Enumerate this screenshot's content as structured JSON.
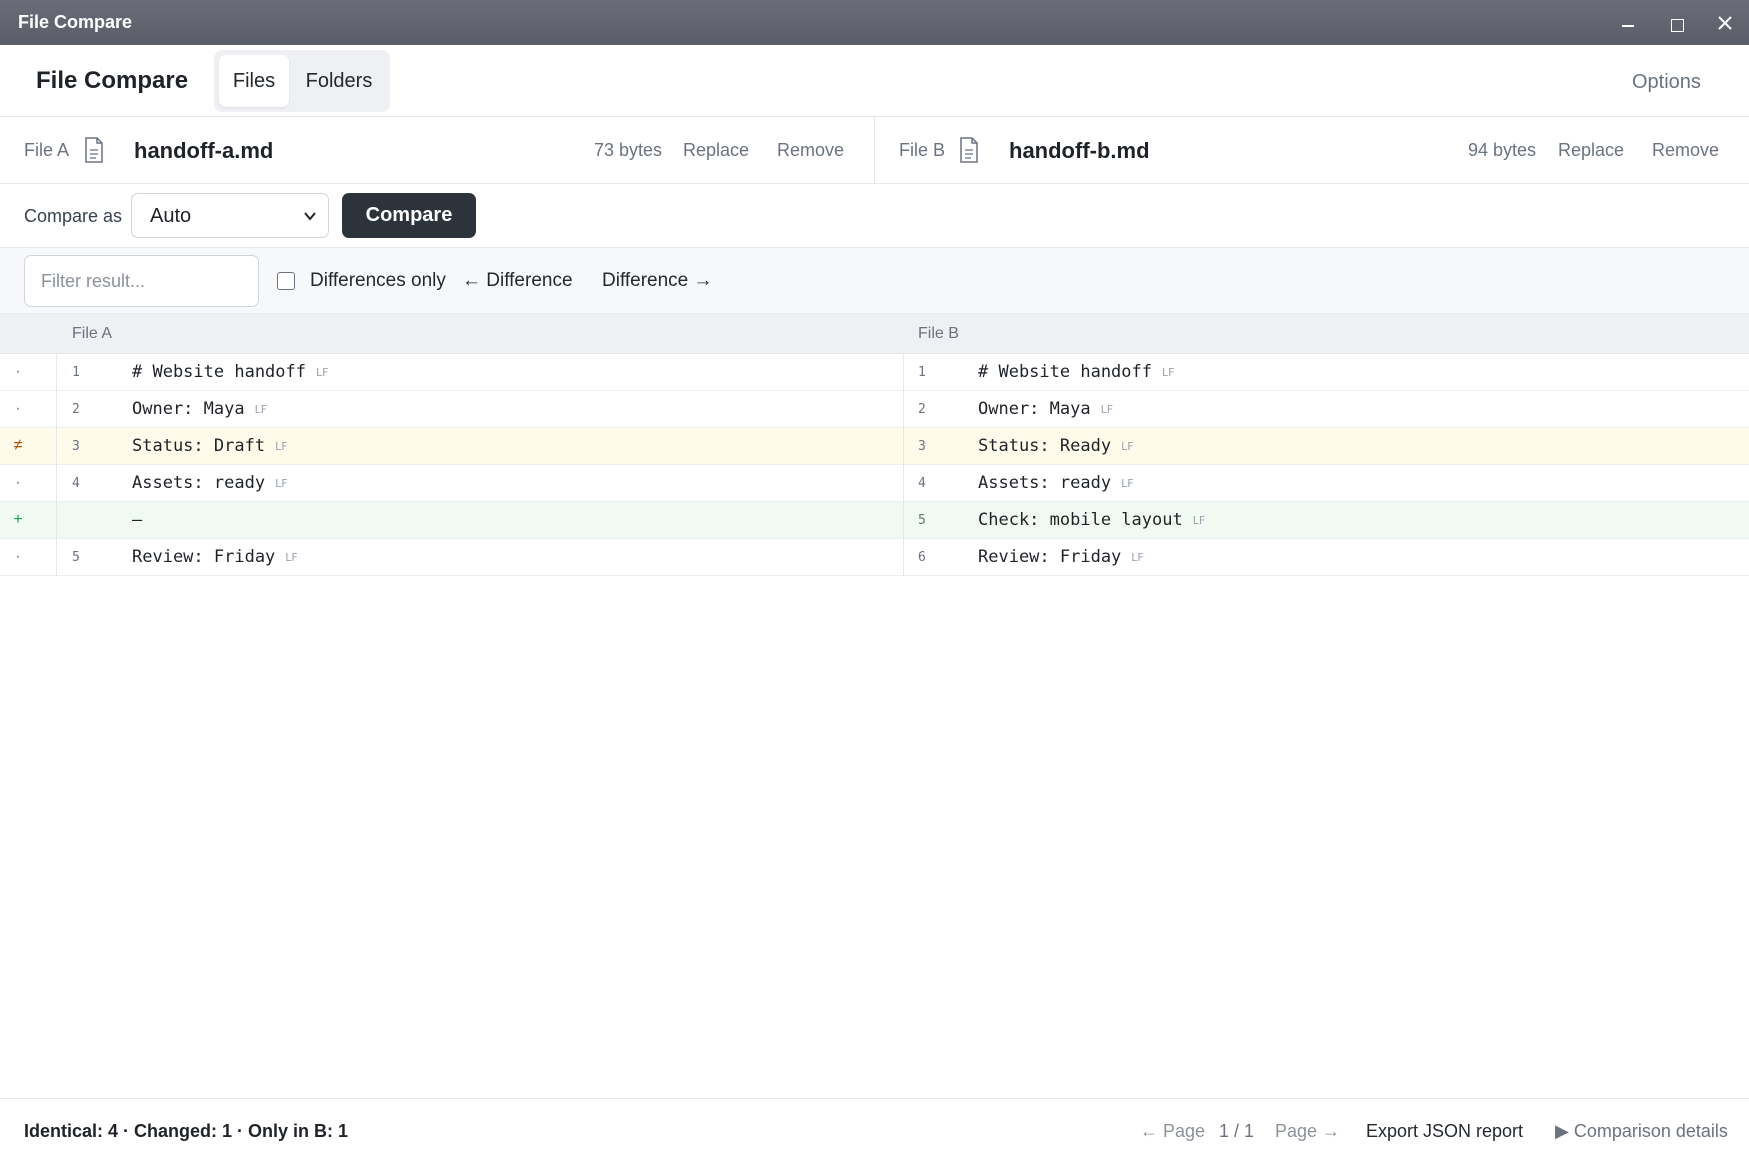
{
  "window": {
    "title": "File Compare"
  },
  "app": {
    "title": "File Compare",
    "tabs": [
      {
        "label": "Files"
      },
      {
        "label": "Folders"
      }
    ],
    "options_label": "Options"
  },
  "files": {
    "a": {
      "label": "File A",
      "name": "handoff-a.md",
      "size": "73 bytes",
      "replace": "Replace",
      "remove": "Remove"
    },
    "b": {
      "label": "File B",
      "name": "handoff-b.md",
      "size": "94 bytes",
      "replace": "Replace",
      "remove": "Remove"
    }
  },
  "compare": {
    "label": "Compare as",
    "mode": "Auto",
    "button": "Compare"
  },
  "filter": {
    "placeholder": "Filter result...",
    "differences_only": "Differences only",
    "prev_diff": "← Difference",
    "next_diff": "Difference →"
  },
  "table": {
    "header_a": "File A",
    "header_b": "File B",
    "eol": "LF",
    "rows": [
      {
        "marker": "·",
        "a_line": "1",
        "a_text": "# Website handoff",
        "b_line": "1",
        "b_text": "# Website handoff",
        "status": "same"
      },
      {
        "marker": "·",
        "a_line": "2",
        "a_text": "Owner: Maya",
        "b_line": "2",
        "b_text": "Owner: Maya",
        "status": "same"
      },
      {
        "marker": "≠",
        "a_line": "3",
        "a_text": "Status: Draft",
        "b_line": "3",
        "b_text": "Status: Ready",
        "status": "changed"
      },
      {
        "marker": "·",
        "a_line": "4",
        "a_text": "Assets: ready",
        "b_line": "4",
        "b_text": "Assets: ready",
        "status": "same"
      },
      {
        "marker": "+",
        "a_line": "",
        "a_text": "—",
        "b_line": "5",
        "b_text": "Check: mobile layout",
        "status": "added"
      },
      {
        "marker": "·",
        "a_line": "5",
        "a_text": "Review: Friday",
        "b_line": "6",
        "b_text": "Review: Friday",
        "status": "same"
      }
    ]
  },
  "footer": {
    "summary": "Identical: 4 · Changed: 1 · Only in B: 1",
    "prev_page": "← Page",
    "page_indicator": "1 / 1",
    "next_page": "Page →",
    "export": "Export JSON report",
    "details": "▶ Comparison details"
  }
}
